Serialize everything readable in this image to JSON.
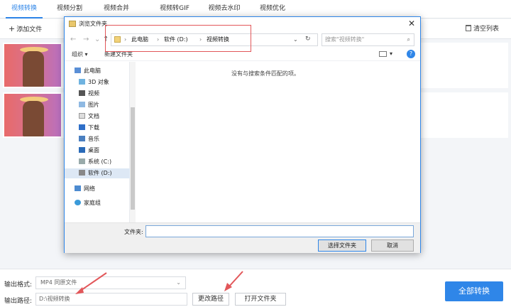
{
  "tabs": [
    "视频转换",
    "视频分割",
    "视频合并",
    "视频转GIF",
    "视频去水印",
    "视频优化"
  ],
  "toolbar": {
    "add_file": "添加文件",
    "clear_list": "清空列表"
  },
  "bottom": {
    "format_label": "输出格式:",
    "format_value": "MP4  同原文件",
    "path_label": "输出路径:",
    "path_value": "D:\\视频转换",
    "change_path": "更改路径",
    "open_folder": "打开文件夹",
    "convert_all": "全部转换"
  },
  "dialog": {
    "title": "浏览文件夹",
    "breadcrumbs": [
      "此电脑",
      "软件 (D:)",
      "视频转换"
    ],
    "search_placeholder": "搜索\"视频转换\"",
    "organize": "组织 ▾",
    "new_folder": "新建文件夹",
    "empty_message": "没有与搜索条件匹配的项。",
    "folder_label": "文件夹:",
    "select_folder": "选择文件夹",
    "cancel": "取消",
    "nav_items": [
      "此电脑",
      "3D 对象",
      "视频",
      "图片",
      "文档",
      "下载",
      "音乐",
      "桌面",
      "系统 (C:)",
      "软件 (D:)",
      "网络",
      "家庭组"
    ]
  },
  "colors": {
    "accent": "#2f86e8",
    "annotation": "#e2575a"
  }
}
